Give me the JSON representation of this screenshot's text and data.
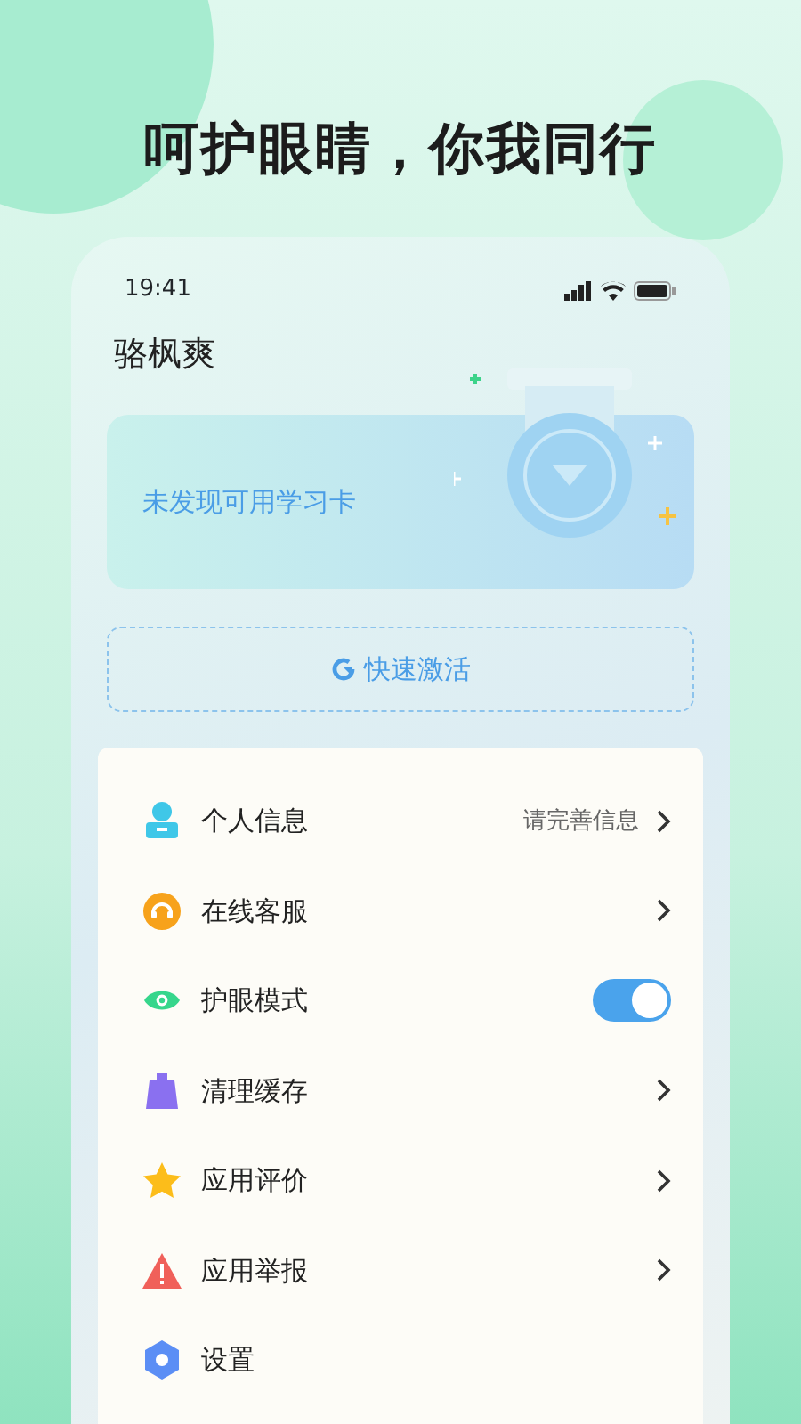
{
  "headline": "呵护眼睛，你我同行",
  "status_bar": {
    "time": "19:41"
  },
  "user": {
    "name": "骆枫爽"
  },
  "card": {
    "message": "未发现可用学习卡"
  },
  "activate_button": {
    "label": "快速激活"
  },
  "menu": [
    {
      "kind": "link",
      "label": "个人信息",
      "value": "请完善信息"
    },
    {
      "kind": "link",
      "label": "在线客服"
    },
    {
      "kind": "toggle",
      "label": "护眼模式",
      "on": true
    },
    {
      "kind": "link",
      "label": "清理缓存"
    },
    {
      "kind": "link",
      "label": "应用评价"
    },
    {
      "kind": "link",
      "label": "应用举报"
    },
    {
      "kind": "plain",
      "label": "设置"
    }
  ]
}
